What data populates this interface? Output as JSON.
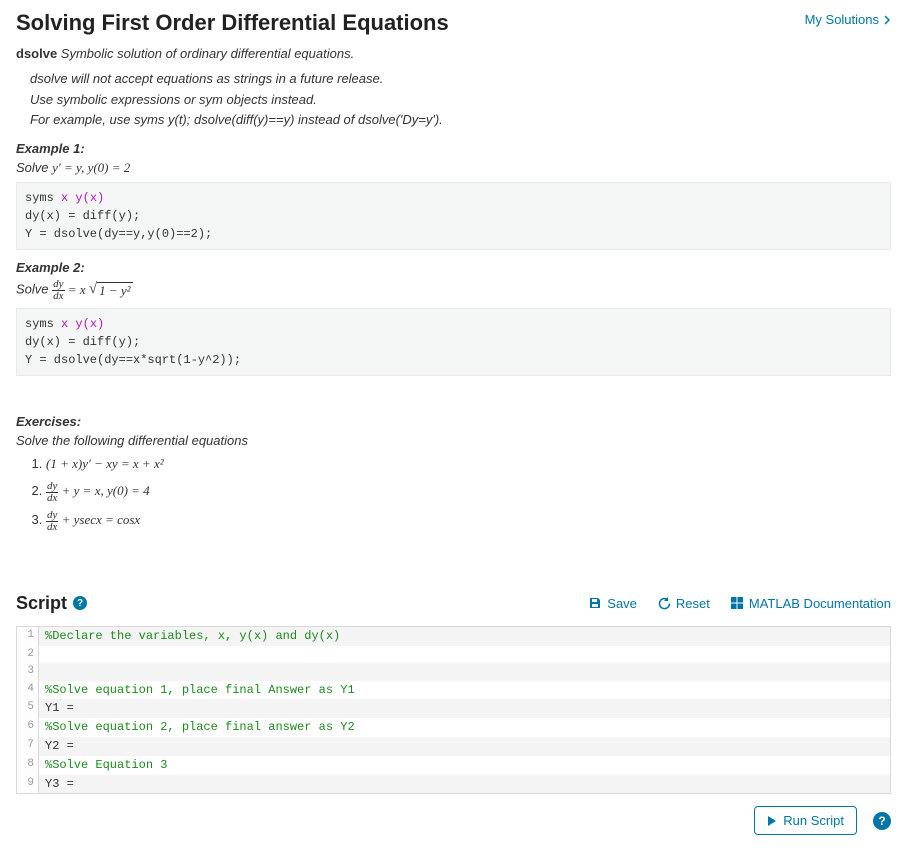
{
  "header": {
    "title": "Solving First Order Differential Equations",
    "my_solutions": "My Solutions"
  },
  "desc": {
    "dsolve_bold": "dsolve",
    "dsolve_rest_1": " Symbolic solution ",
    "dsolve_rest_2": "of ordinary differential equations.",
    "line2": "dsolve will not accept equations as strings in a future release.",
    "line3": "Use symbolic expressions or sym objects instead.",
    "line4": "For example, use syms y(t); dsolve(diff(y)==y) instead of  dsolve('Dy=y')."
  },
  "example1": {
    "title": "Example 1:",
    "solve_prefix": "Solve ",
    "equation_plain": "y′ = y, y(0) = 2",
    "code_l1a": "syms ",
    "code_l1b": "x y(x)",
    "code_l2": "dy(x) = diff(y);",
    "code_l3": "Y = dsolve(dy==y,y(0)==2);"
  },
  "example2": {
    "title": "Example 2:",
    "solve_prefix": "Solve ",
    "frac_num": "dy",
    "frac_den": "dx",
    "eq_mid": " = x ",
    "sqrt_body": "1 − y²",
    "code_l1a": "syms ",
    "code_l1b": "x y(x)",
    "code_l2": "dy(x) = diff(y);",
    "code_l3": "Y = dsolve(dy==x*sqrt(1-y^2));"
  },
  "exercises": {
    "title": "Exercises:",
    "subtitle": "Solve the following differential equations",
    "item1": "(1 + x)y′ − xy = x + x²",
    "item2_frac_num": "dy",
    "item2_frac_den": "dx",
    "item2_rest": " + y = x, y(0) = 4",
    "item3_frac_num": "dy",
    "item3_frac_den": "dx",
    "item3_rest": " + ysecx = cosx"
  },
  "script": {
    "heading": "Script",
    "actions": {
      "save": "Save",
      "reset": "Reset",
      "docs": "MATLAB Documentation"
    },
    "lines": [
      {
        "n": "1",
        "text": "%Declare the variables, x, y(x) and dy(x)",
        "comment": true
      },
      {
        "n": "2",
        "text": "",
        "comment": false
      },
      {
        "n": "3",
        "text": "",
        "comment": false
      },
      {
        "n": "4",
        "text": "%Solve equation 1, place final Answer as Y1",
        "comment": true
      },
      {
        "n": "5",
        "text": "Y1 = ",
        "comment": false
      },
      {
        "n": "6",
        "text": "%Solve equation 2, place final answer as Y2",
        "comment": true
      },
      {
        "n": "7",
        "text": "Y2 = ",
        "comment": false
      },
      {
        "n": "8",
        "text": "%Solve Equation 3",
        "comment": true
      },
      {
        "n": "9",
        "text": "Y3 = ",
        "comment": false
      }
    ],
    "run": "Run Script"
  }
}
